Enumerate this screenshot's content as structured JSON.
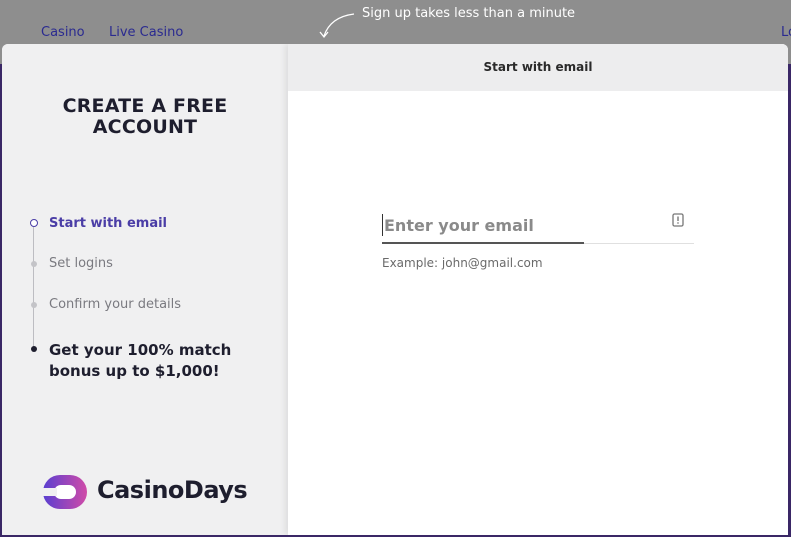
{
  "site_nav": {
    "casino": "Casino",
    "live_casino": "Live Casino",
    "login": "Lo"
  },
  "hint": "Sign up takes less than a minute",
  "modal": {
    "left": {
      "title_line1": "CREATE A FREE",
      "title_line2": "ACCOUNT",
      "steps": [
        {
          "label": "Start with email"
        },
        {
          "label": "Set logins"
        },
        {
          "label": "Confirm your details"
        },
        {
          "label": "Get your 100% match bonus up to $1,000!"
        }
      ],
      "logo_text": "CasinoDays"
    },
    "right": {
      "header": "Start with email",
      "email_placeholder": "Enter your email",
      "email_value": "",
      "email_hint": "Example: john@gmail.com"
    }
  },
  "colors": {
    "accent": "#4a3da6",
    "logo_gradient_start": "#5a3fd0",
    "logo_gradient_end": "#d04ba8"
  }
}
